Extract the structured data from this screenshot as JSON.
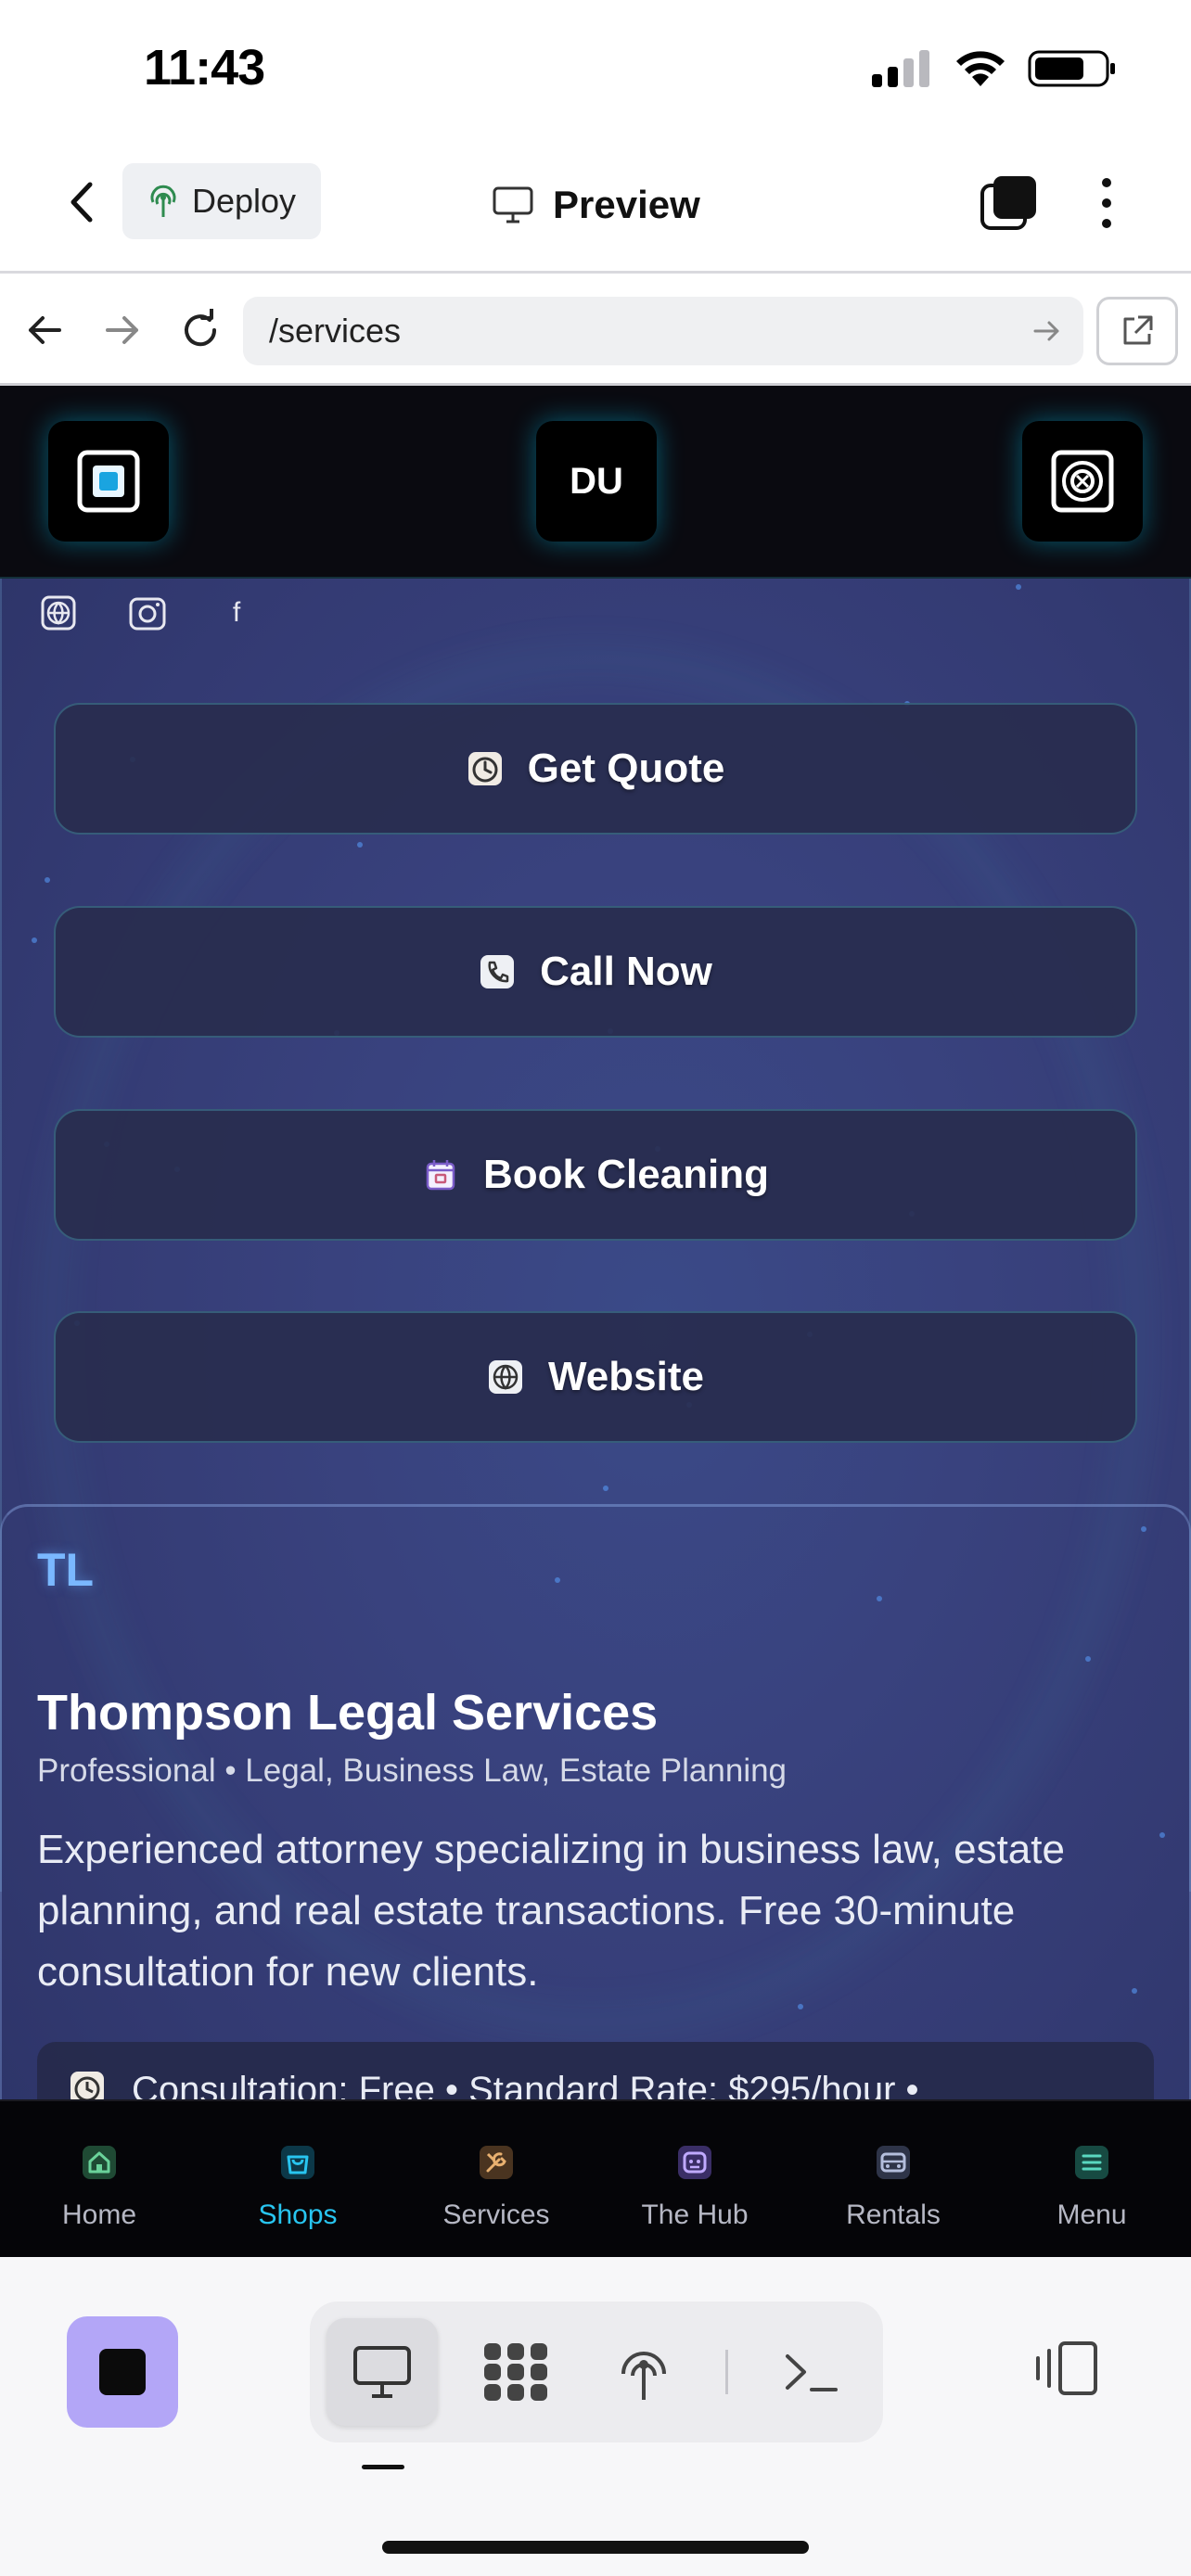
{
  "status": {
    "time": "11:43"
  },
  "app_bar": {
    "deploy_label": "Deploy",
    "title": "Preview"
  },
  "browser": {
    "url": "/services"
  },
  "site_header": {
    "center_label": "DU"
  },
  "social": {
    "facebook_glyph": "f"
  },
  "actions": [
    {
      "label": "Get Quote",
      "icon": "clock-icon"
    },
    {
      "label": "Call Now",
      "icon": "phone-icon"
    },
    {
      "label": "Book Cleaning",
      "icon": "calendar-icon"
    },
    {
      "label": "Website",
      "icon": "globe-icon"
    }
  ],
  "listing": {
    "initials": "TL",
    "name": "Thompson Legal Services",
    "meta": "Professional • Legal, Business Law, Estate Planning",
    "description": "Experienced attorney specializing in business law, estate planning, and real estate transactions. Free 30-minute consultation for new clients.",
    "pricing": "Consultation: Free • Standard Rate: $295/hour •"
  },
  "web_nav": [
    {
      "label": "Home",
      "icon": "home-icon",
      "color": "#4caf7a"
    },
    {
      "label": "Shops",
      "icon": "shopping-bag-icon",
      "color": "#28c5f0",
      "active": true
    },
    {
      "label": "Services",
      "icon": "tools-icon",
      "color": "#d8a060"
    },
    {
      "label": "The Hub",
      "icon": "hub-icon",
      "color": "#a88ef0"
    },
    {
      "label": "Rentals",
      "icon": "car-icon",
      "color": "#9aa6c8"
    },
    {
      "label": "Menu",
      "icon": "menu-icon",
      "color": "#3ec0a8"
    }
  ],
  "colors": {
    "accent": "#28c5f0",
    "stop_button": "#b3a6f7",
    "web_bg": "#39427e"
  }
}
